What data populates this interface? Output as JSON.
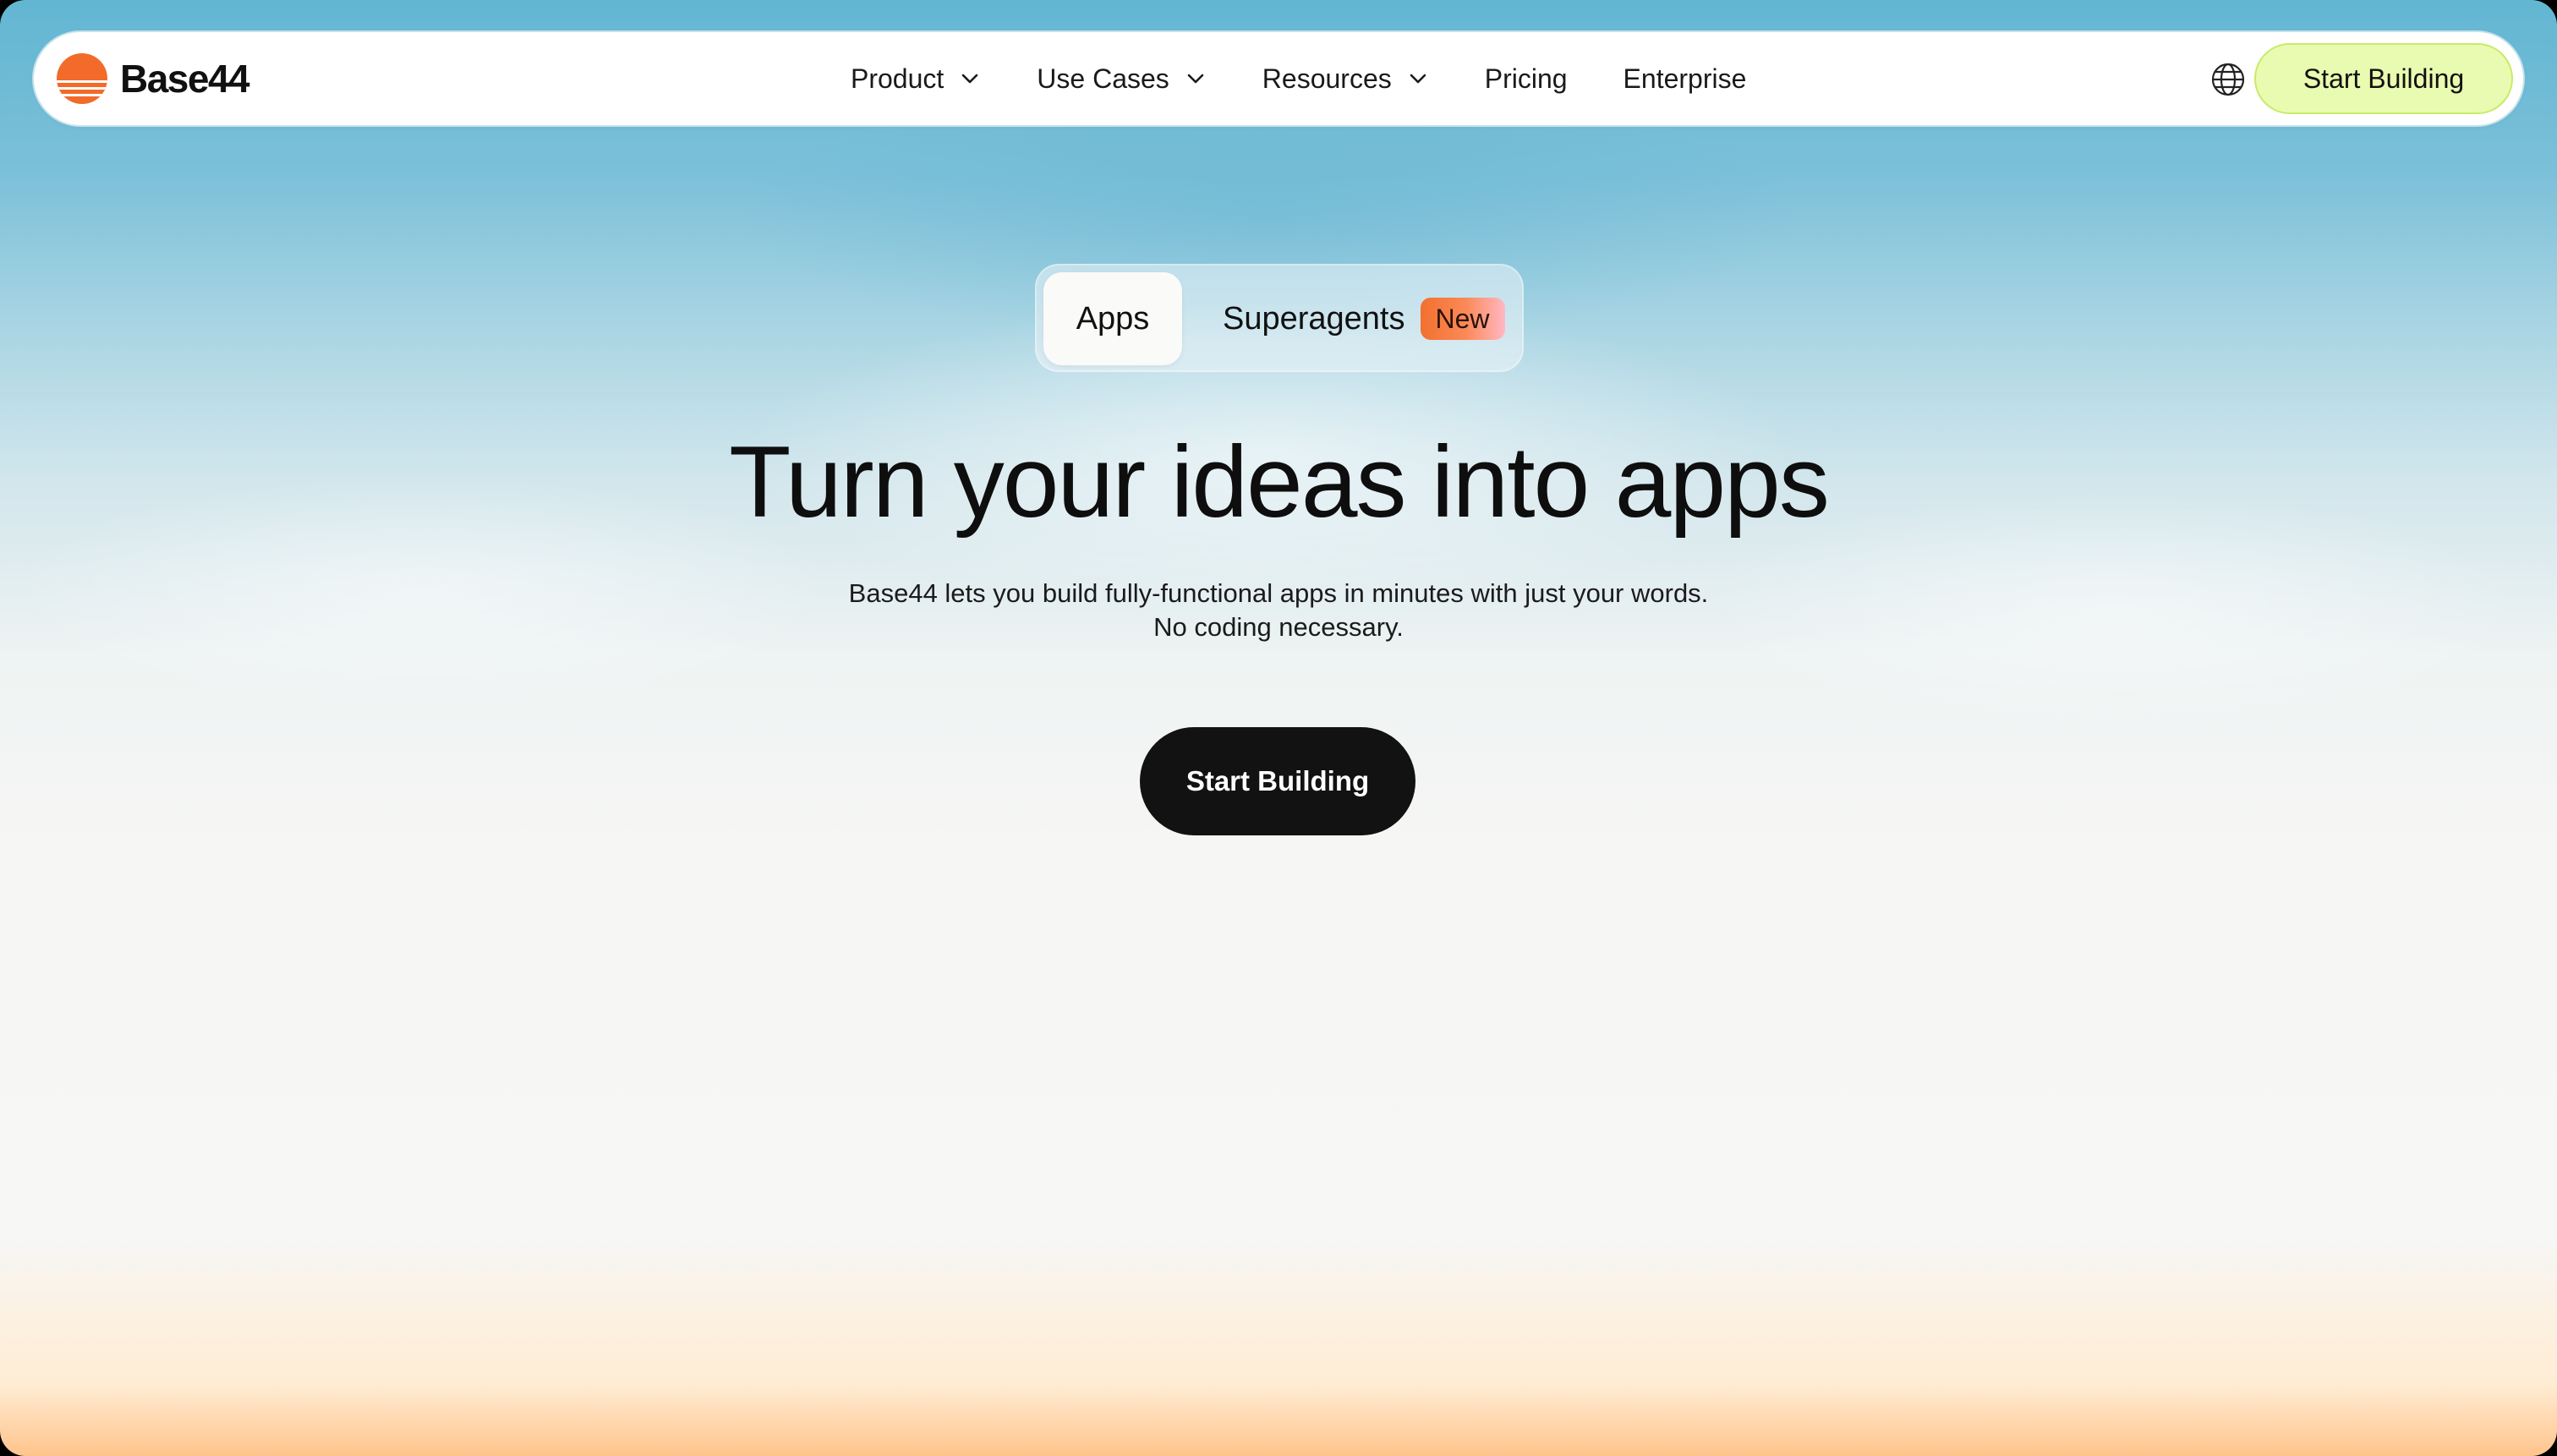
{
  "brand": {
    "name": "Base44",
    "logo_icon": "base44-sun-logo",
    "accent": "#f26b2a"
  },
  "nav": {
    "items": [
      {
        "label": "Product",
        "has_dropdown": true
      },
      {
        "label": "Use Cases",
        "has_dropdown": true
      },
      {
        "label": "Resources",
        "has_dropdown": true
      },
      {
        "label": "Pricing",
        "has_dropdown": false
      },
      {
        "label": "Enterprise",
        "has_dropdown": false
      }
    ],
    "language_icon": "globe-icon",
    "cta_label": "Start Building",
    "cta_color": "#e9fbb0"
  },
  "toggle": {
    "apps_label": "Apps",
    "superagents_label": "Superagents",
    "new_badge": "New",
    "selected": "Apps"
  },
  "hero": {
    "title": "Turn your ideas into apps",
    "subtitle_line1": "Base44 lets you build fully-functional apps in minutes with just your words.",
    "subtitle_line2": "No coding necessary.",
    "cta_label": "Start Building",
    "cta_color": "#121212"
  }
}
